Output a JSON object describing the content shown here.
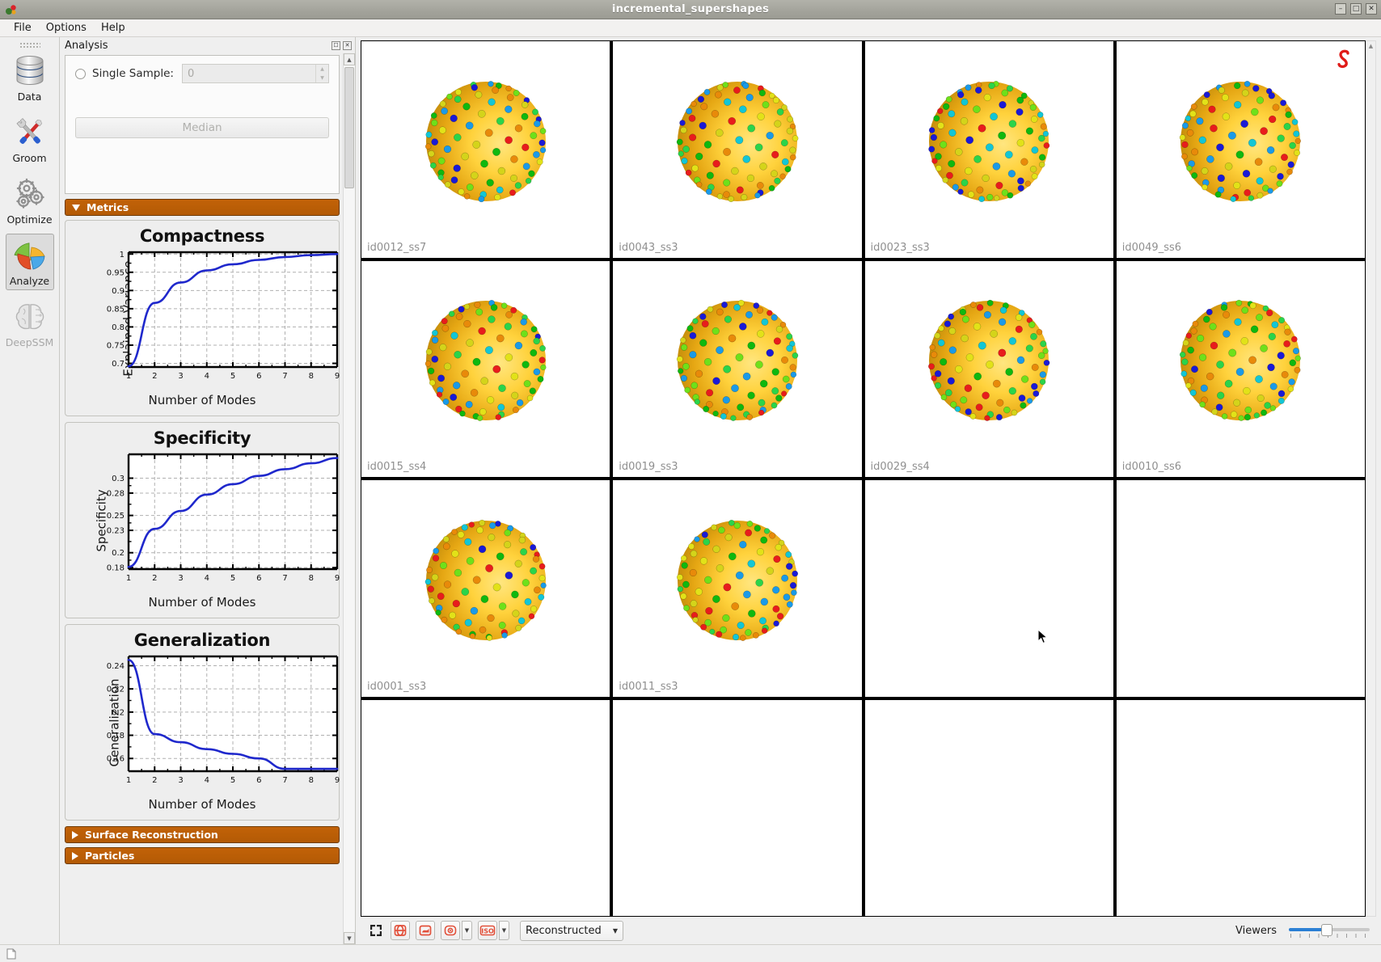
{
  "window": {
    "title": "incremental_supershapes",
    "app_icon": "shapeworks-icon",
    "buttons": [
      {
        "name": "minimize-button",
        "glyph": "–"
      },
      {
        "name": "maximize-button",
        "glyph": "□"
      },
      {
        "name": "close-button",
        "glyph": "✕"
      }
    ]
  },
  "menubar": {
    "items": [
      {
        "name": "menu-file",
        "label": "File"
      },
      {
        "name": "menu-options",
        "label": "Options"
      },
      {
        "name": "menu-help",
        "label": "Help"
      }
    ]
  },
  "rail": {
    "items": [
      {
        "name": "rail-data",
        "label": "Data",
        "icon": "database-icon",
        "selected": false,
        "disabled": false
      },
      {
        "name": "rail-groom",
        "label": "Groom",
        "icon": "tools-icon",
        "selected": false,
        "disabled": false
      },
      {
        "name": "rail-optimize",
        "label": "Optimize",
        "icon": "gears-icon",
        "selected": false,
        "disabled": false
      },
      {
        "name": "rail-analyze",
        "label": "Analyze",
        "icon": "pie-chart-icon",
        "selected": true,
        "disabled": false
      },
      {
        "name": "rail-deepssm",
        "label": "DeepSSM",
        "icon": "brain-icon",
        "selected": false,
        "disabled": true
      }
    ]
  },
  "dock": {
    "title": "Analysis",
    "float_button": "float-icon",
    "close_button": "close-icon",
    "sample": {
      "radio_label": "Single Sample:",
      "spin_value": "0",
      "median_button": "Median"
    },
    "sections": [
      {
        "name": "section-metrics",
        "label": "Metrics",
        "expanded": true
      },
      {
        "name": "section-surface-reconstruction",
        "label": "Surface Reconstruction",
        "expanded": false
      },
      {
        "name": "section-particles",
        "label": "Particles",
        "expanded": false
      }
    ]
  },
  "chart_data": [
    {
      "type": "line",
      "name": "compactness",
      "title": "Compactness",
      "xlabel": "Number of Modes",
      "ylabel": "Explained Variance",
      "x": [
        1,
        2,
        3,
        4,
        5,
        6,
        7,
        8,
        9
      ],
      "values": [
        0.692,
        0.866,
        0.922,
        0.955,
        0.972,
        0.984,
        0.992,
        0.997,
        1.0
      ],
      "xticks": [
        "1",
        "2",
        "3",
        "4",
        "5",
        "6",
        "7",
        "8",
        "9"
      ],
      "yticks": [
        "0.7",
        "0.75",
        "0.8",
        "0.85",
        "0.9",
        "0.95",
        "1"
      ],
      "ytickvals": [
        0.7,
        0.75,
        0.8,
        0.85,
        0.9,
        0.95,
        1.0
      ],
      "xlim": [
        1,
        9
      ],
      "ylim": [
        0.69,
        1.005
      ],
      "grid": true,
      "line_color": "#1f28cc"
    },
    {
      "type": "line",
      "name": "specificity",
      "title": "Specificity",
      "xlabel": "Number of Modes",
      "ylabel": "Specificity",
      "x": [
        1,
        2,
        3,
        4,
        5,
        6,
        7,
        8,
        9
      ],
      "values": [
        0.181,
        0.232,
        0.256,
        0.278,
        0.292,
        0.303,
        0.312,
        0.32,
        0.327
      ],
      "xticks": [
        "1",
        "2",
        "3",
        "4",
        "5",
        "6",
        "7",
        "8",
        "9"
      ],
      "yticks": [
        "0.18",
        "0.2",
        "0.23",
        "0.25",
        "0.28",
        "0.3"
      ],
      "ytickvals": [
        0.18,
        0.2,
        0.23,
        0.25,
        0.28,
        0.3
      ],
      "xlim": [
        1,
        9
      ],
      "ylim": [
        0.178,
        0.332
      ],
      "grid": true,
      "line_color": "#1f28cc"
    },
    {
      "type": "line",
      "name": "generalization",
      "title": "Generalization",
      "xlabel": "Number of Modes",
      "ylabel": "Generalization",
      "x": [
        1,
        2,
        3,
        4,
        5,
        6,
        7,
        8,
        9
      ],
      "values": [
        0.245,
        0.181,
        0.174,
        0.168,
        0.164,
        0.16,
        0.151,
        0.151,
        0.151
      ],
      "xticks": [
        "1",
        "2",
        "3",
        "4",
        "5",
        "6",
        "7",
        "8",
        "9"
      ],
      "yticks": [
        "0.16",
        "0.18",
        "0.2",
        "0.22",
        "0.24"
      ],
      "ytickvals": [
        0.16,
        0.18,
        0.2,
        0.22,
        0.24
      ],
      "xlim": [
        1,
        9
      ],
      "ylim": [
        0.149,
        0.248
      ],
      "grid": true,
      "line_color": "#1f28cc"
    }
  ],
  "viewer": {
    "logo": "shapeworks-s-logo",
    "rows": 4,
    "cols": 4,
    "cells": [
      {
        "name": "viewer-cell-0",
        "label": "id0012_ss7",
        "has_shape": true
      },
      {
        "name": "viewer-cell-1",
        "label": "id0043_ss3",
        "has_shape": true
      },
      {
        "name": "viewer-cell-2",
        "label": "id0023_ss3",
        "has_shape": true
      },
      {
        "name": "viewer-cell-3",
        "label": "id0049_ss6",
        "has_shape": true
      },
      {
        "name": "viewer-cell-4",
        "label": "id0015_ss4",
        "has_shape": true
      },
      {
        "name": "viewer-cell-5",
        "label": "id0019_ss3",
        "has_shape": true
      },
      {
        "name": "viewer-cell-6",
        "label": "id0029_ss4",
        "has_shape": true
      },
      {
        "name": "viewer-cell-7",
        "label": "id0010_ss6",
        "has_shape": true
      },
      {
        "name": "viewer-cell-8",
        "label": "id0001_ss3",
        "has_shape": true
      },
      {
        "name": "viewer-cell-9",
        "label": "id0011_ss3",
        "has_shape": true
      },
      {
        "name": "viewer-cell-10",
        "label": "",
        "has_shape": false
      },
      {
        "name": "viewer-cell-11",
        "label": "",
        "has_shape": false
      },
      {
        "name": "viewer-cell-12",
        "label": "",
        "has_shape": false
      },
      {
        "name": "viewer-cell-13",
        "label": "",
        "has_shape": false
      },
      {
        "name": "viewer-cell-14",
        "label": "",
        "has_shape": false
      },
      {
        "name": "viewer-cell-15",
        "label": "",
        "has_shape": false
      }
    ]
  },
  "toolbar": {
    "buttons": [
      {
        "name": "zoom-to-fit-button",
        "icon": "zoom-to-fit-icon"
      },
      {
        "name": "show-glyphs-button",
        "icon": "glyphs-icon"
      },
      {
        "name": "show-surface-button",
        "icon": "surface-icon"
      },
      {
        "name": "view-mode-button",
        "icon": "eye-icon"
      },
      {
        "name": "iso-view-button",
        "icon": "iso-icon"
      }
    ],
    "combo": {
      "name": "display-mode-combo",
      "value": "Reconstructed",
      "arrow": "chevron-down-icon"
    },
    "viewers_label": "Viewers",
    "viewers_value": 4
  },
  "statusbar": {
    "icon": "document-icon",
    "text": ""
  },
  "colors": {
    "accent_orange": "#b35a05",
    "line_blue": "#1f28cc",
    "slider_blue": "#2a7fd4",
    "logo_red": "#e01b18",
    "toolbar_icon_red": "#e2503a"
  }
}
